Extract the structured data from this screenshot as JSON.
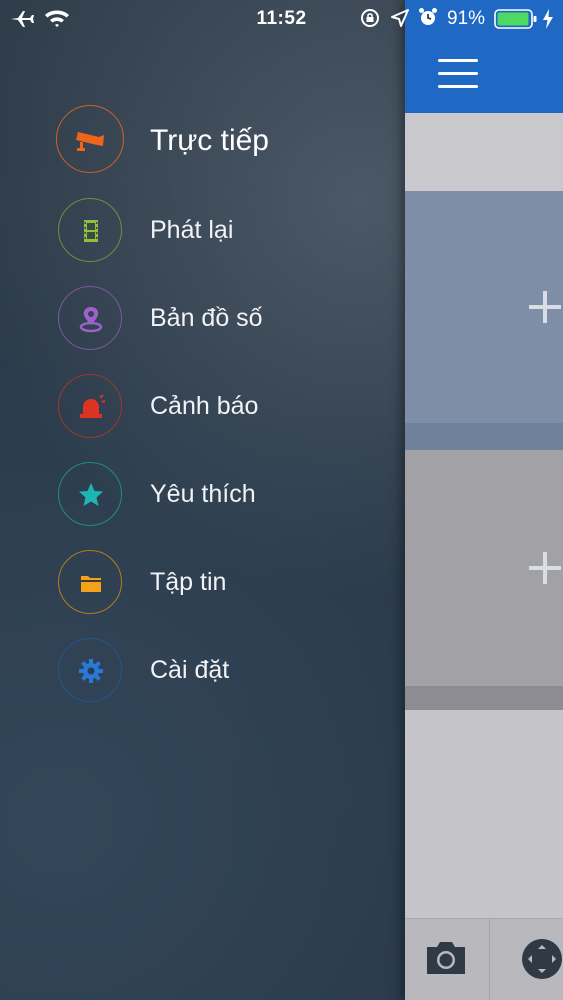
{
  "status_bar": {
    "time": "11:52",
    "battery_percent": "91%",
    "icons": [
      "airplane-icon",
      "wifi-icon",
      "orientation-lock-icon",
      "location-icon",
      "alarm-icon",
      "battery-icon",
      "charging-icon"
    ]
  },
  "drawer": {
    "items": [
      {
        "label": "Trực tiếp",
        "icon": "cctv-camera-icon",
        "color": "#f0651c"
      },
      {
        "label": "Phát lại",
        "icon": "film-icon",
        "color": "#8fbf3f"
      },
      {
        "label": "Bản đồ số",
        "icon": "map-pin-icon",
        "color": "#9c62c8"
      },
      {
        "label": "Cảnh báo",
        "icon": "alarm-siren-icon",
        "color": "#dd3322"
      },
      {
        "label": "Yêu thích",
        "icon": "star-icon",
        "color": "#1eb6b2"
      },
      {
        "label": "Tập tin",
        "icon": "folder-icon",
        "color": "#f3a21a"
      },
      {
        "label": "Cài đặt",
        "icon": "gear-icon",
        "color": "#2a78d8"
      }
    ]
  },
  "content": {
    "header_color": "#1f68c3",
    "tiles": [
      "add-camera",
      "add-camera"
    ],
    "bottom_toolbar": [
      "camera-icon",
      "ptz-control-icon"
    ]
  }
}
